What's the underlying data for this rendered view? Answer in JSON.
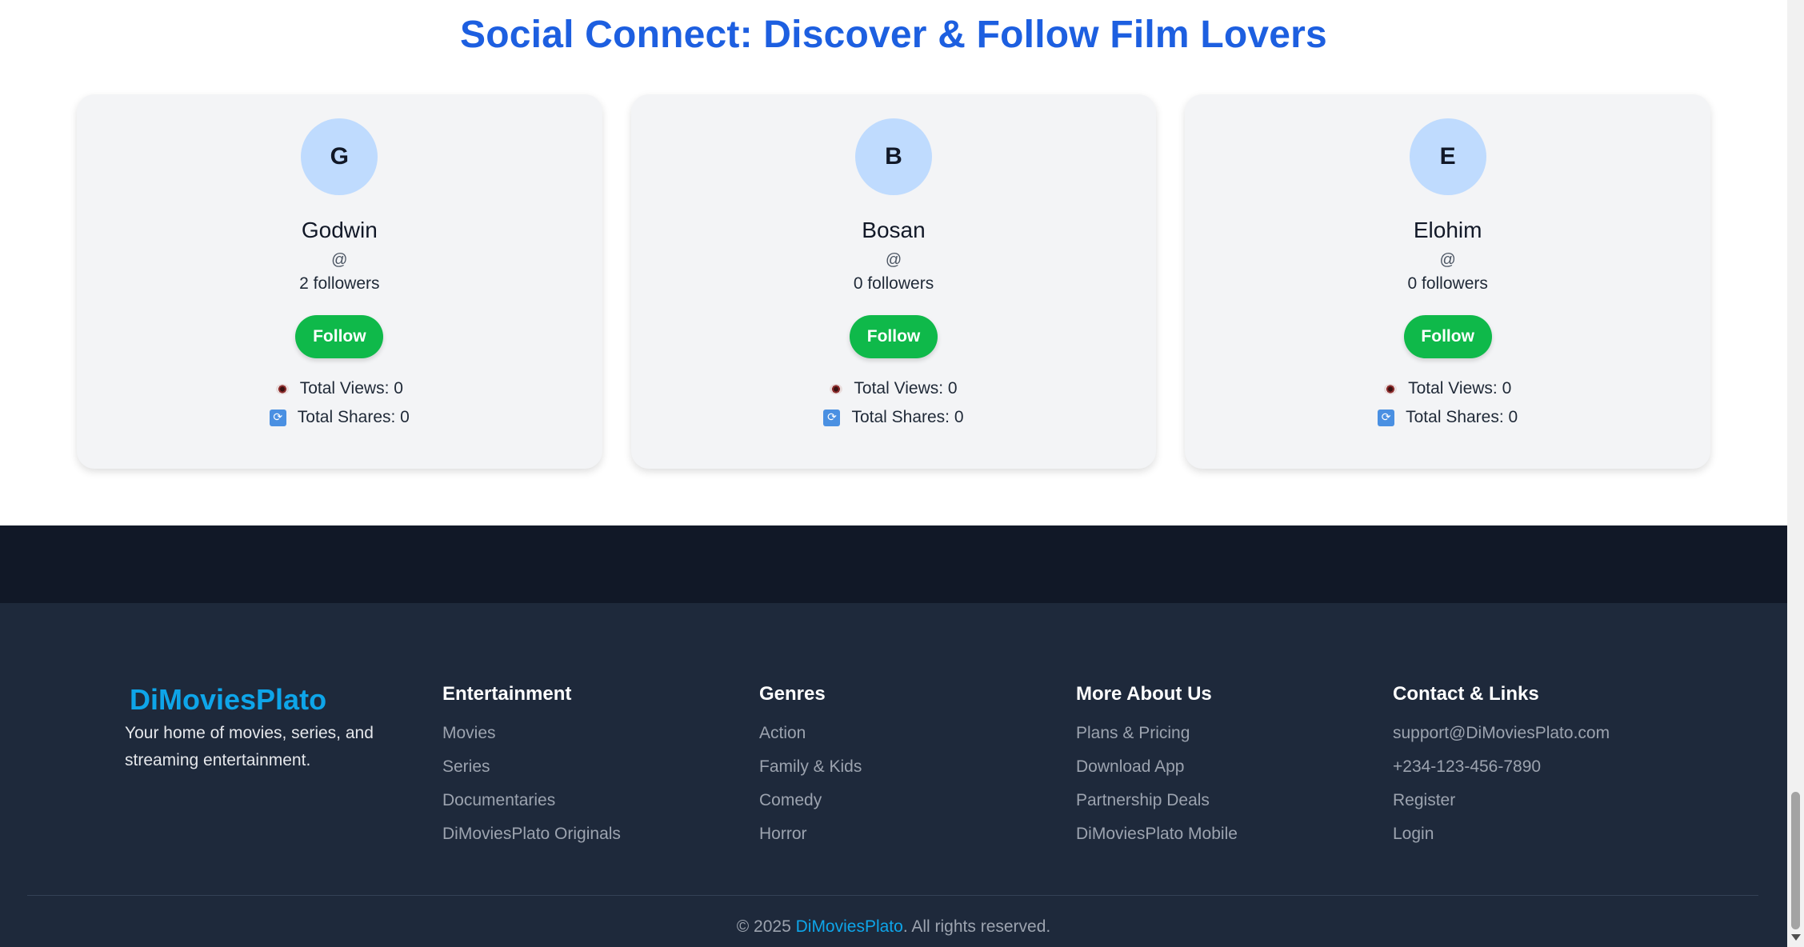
{
  "social": {
    "title": "Social Connect: Discover & Follow Film Lovers",
    "cards": [
      {
        "initial": "G",
        "name": "Godwin",
        "handle": "@",
        "followers": "2 followers",
        "follow_label": "Follow",
        "views": "Total Views: 0",
        "shares": "Total Shares: 0"
      },
      {
        "initial": "B",
        "name": "Bosan",
        "handle": "@",
        "followers": "0 followers",
        "follow_label": "Follow",
        "views": "Total Views: 0",
        "shares": "Total Shares: 0"
      },
      {
        "initial": "E",
        "name": "Elohim",
        "handle": "@",
        "followers": "0 followers",
        "follow_label": "Follow",
        "views": "Total Views: 0",
        "shares": "Total Shares: 0"
      }
    ],
    "icons": {
      "views": "eye-icon",
      "shares": "share-icon"
    }
  },
  "footer": {
    "brand": "DiMoviesPlato",
    "tagline": "Your home of movies, series, and streaming entertainment.",
    "columns": [
      {
        "heading": "Entertainment",
        "links": [
          "Movies",
          "Series",
          "Documentaries",
          "DiMoviesPlato Originals"
        ]
      },
      {
        "heading": "Genres",
        "links": [
          "Action",
          "Family & Kids",
          "Comedy",
          "Horror"
        ]
      },
      {
        "heading": "More About Us",
        "links": [
          "Plans & Pricing",
          "Download App",
          "Partnership Deals",
          "DiMoviesPlato Mobile"
        ]
      },
      {
        "heading": "Contact & Links",
        "links": [
          "support@DiMoviesPlato.com",
          "+234-123-456-7890",
          "Register",
          "Login"
        ]
      }
    ],
    "copyright_prefix": "© 2025 ",
    "copyright_brand": "DiMoviesPlato",
    "copyright_suffix": ". All rights reserved."
  },
  "colors": {
    "title": "#1d5fe0",
    "follow_button": "#0fb94a",
    "avatar_bg": "#bfdbfe",
    "footer_bg": "#1e293b",
    "footer_top_bg": "#111827",
    "brand": "#0ea5e9"
  }
}
